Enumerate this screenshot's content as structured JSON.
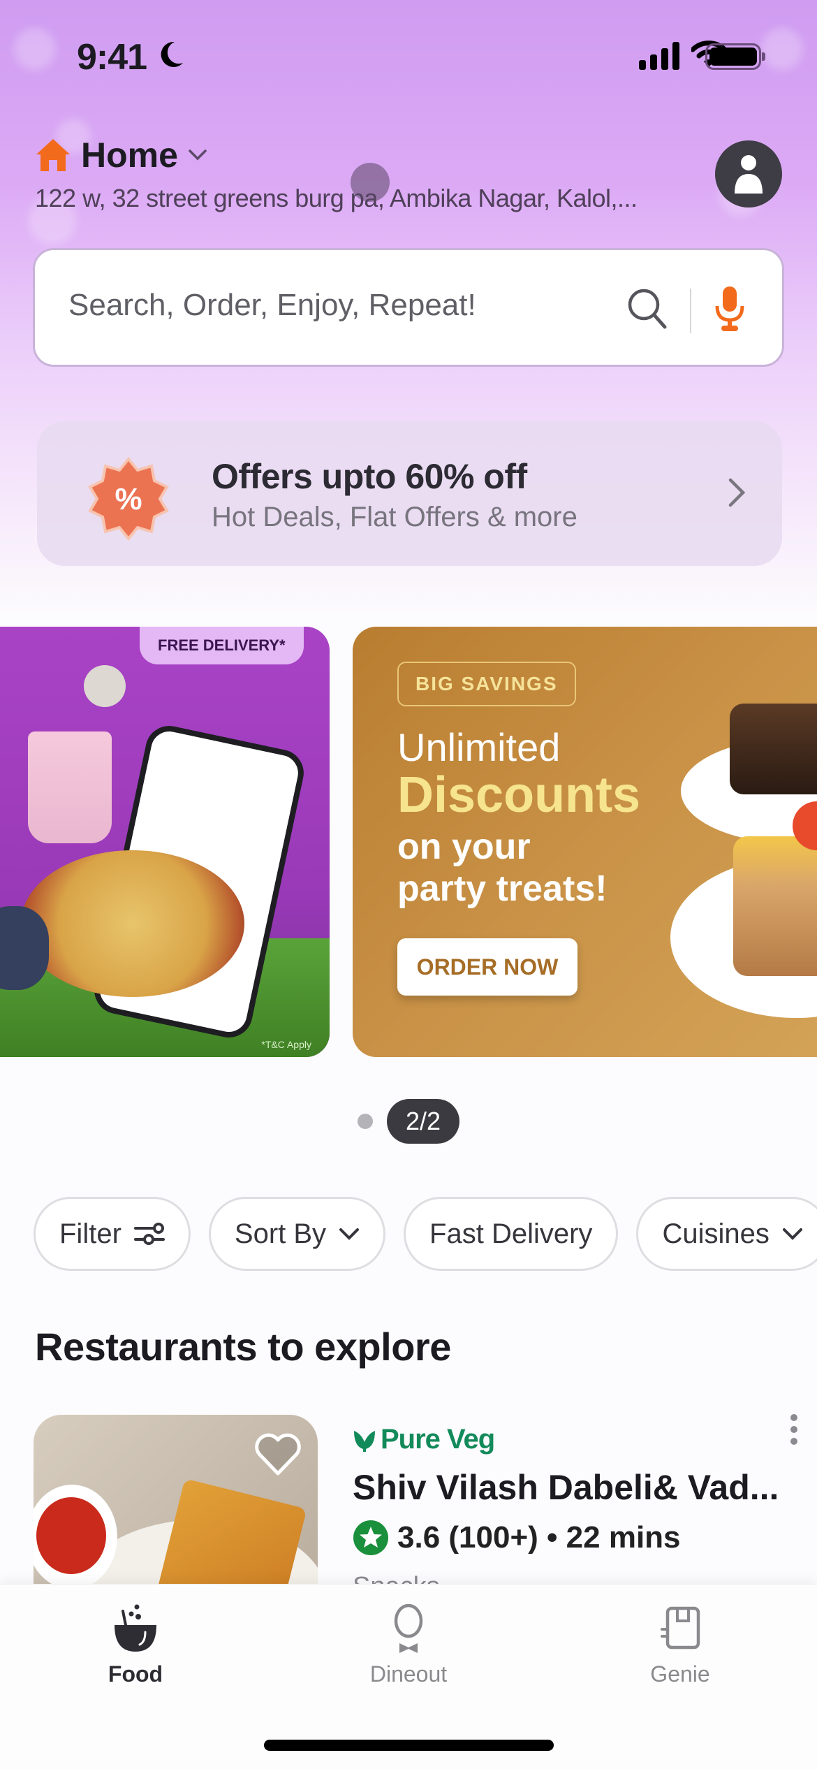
{
  "status_bar": {
    "time": "9:41",
    "focus_icon": "moon-icon",
    "icons": [
      "signal-icon",
      "wifi-icon",
      "battery-icon"
    ]
  },
  "header": {
    "location_label": "Home",
    "address": "122 w, 32 street greens burg pa, Ambika Nagar, Kalol,...",
    "accent_color": "#f26a1b"
  },
  "search": {
    "placeholder": "Search, Order, Enjoy, Repeat!"
  },
  "offers": {
    "title": "Offers upto 60% off",
    "subtitle": "Hot Deals, Flat Offers & more",
    "badge_symbol": "%"
  },
  "banners": [
    {
      "tag": "FREE DELIVERY*",
      "disclaimer": "*T&C Apply"
    },
    {
      "tag": "BIG SAVINGS",
      "line1": "Unlimited",
      "line2": "Discounts",
      "line3": "on your",
      "line4": "party treats!",
      "cta": "ORDER NOW"
    }
  ],
  "pager": {
    "current": "2/2"
  },
  "chips": [
    {
      "label": "Filter"
    },
    {
      "label": "Sort By"
    },
    {
      "label": "Fast Delivery"
    },
    {
      "label": "Cuisines"
    }
  ],
  "section": {
    "title": "Restaurants to explore"
  },
  "restaurant": {
    "badge": "Pure Veg",
    "name": "Shiv Vilash Dabeli& Vad...",
    "rating": "3.6 (100+) • 22 mins",
    "cuisine": "Snacks",
    "badge_color": "#128a5a"
  },
  "tabs": [
    {
      "label": "Food",
      "active": true
    },
    {
      "label": "Dineout",
      "active": false
    },
    {
      "label": "Genie",
      "active": false
    }
  ]
}
